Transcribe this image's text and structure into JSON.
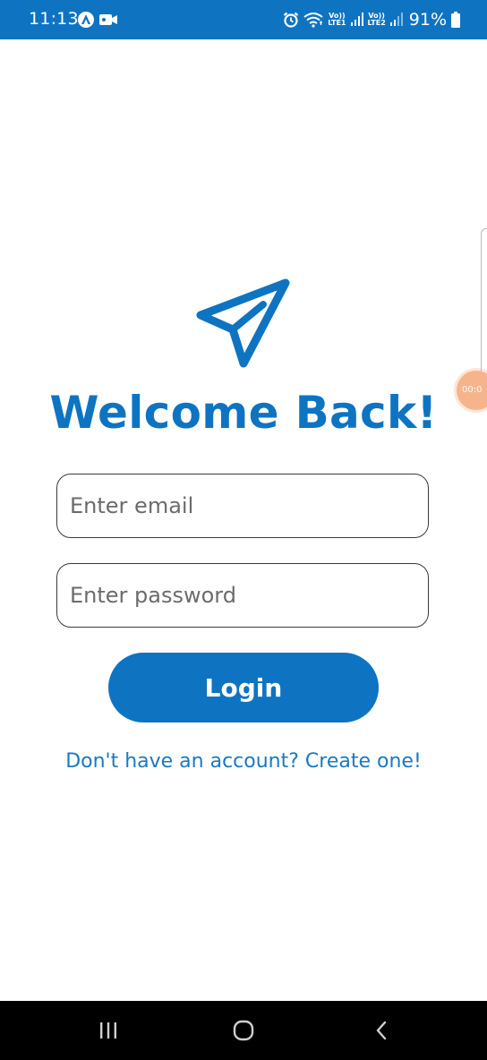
{
  "status_bar": {
    "time": "11:13",
    "lte1_top": "Vo))",
    "lte1_bottom": "LTE1",
    "lte2_top": "Vo))",
    "lte2_bottom": "LTE2",
    "battery_percent": "91%",
    "background_color": "#0e74c2",
    "icons": [
      "app-notification-icon",
      "video-camera-icon",
      "alarm-icon",
      "wifi-icon",
      "signal-icon",
      "battery-icon"
    ]
  },
  "floating": {
    "record_timer": "00:0"
  },
  "login": {
    "logo_icon": "paper-plane-icon",
    "title": "Welcome Back!",
    "email_placeholder": "Enter email",
    "password_placeholder": "Enter password",
    "login_label": "Login",
    "create_account_text": "Don't have an account? Create one!",
    "accent_color": "#0e74c2"
  },
  "nav_bar": {
    "icons": [
      "recent-apps-icon",
      "home-icon",
      "back-icon"
    ]
  }
}
